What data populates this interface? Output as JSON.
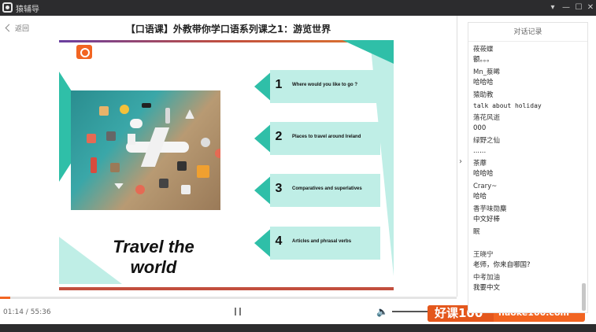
{
  "app": {
    "title": "猿辅导"
  },
  "window_controls": [
    "▾",
    "—",
    "☐",
    "✕"
  ],
  "header": {
    "back_label": "返回",
    "course_title": "【口语课】外教带你学口语系列课之1：游览世界"
  },
  "slide": {
    "title": "Travel the world",
    "items": [
      {
        "num": "1",
        "text": "Where would you like to go ?"
      },
      {
        "num": "2",
        "text": "Places to travel around Ireland"
      },
      {
        "num": "3",
        "text": "Comparatives and superlatives"
      },
      {
        "num": "4",
        "text": "Articles and phrasal verbs"
      }
    ]
  },
  "player": {
    "time": "01:14 / 55:36",
    "progress_fraction": 0.022
  },
  "watermark": {
    "left": "好课100",
    "right": "haoke100.com"
  },
  "chat": {
    "title": "对话记录",
    "messages": [
      {
        "user": "莜莜蝶",
        "text": "额。。。"
      },
      {
        "user": "Mn_蔡晞",
        "text": "哈哈哈"
      },
      {
        "user": "猿助教",
        "text": "talk about holiday"
      },
      {
        "user": "落花风逝",
        "text": "000"
      },
      {
        "user": "绿野之仙",
        "text": "......"
      },
      {
        "user": "茶蘼",
        "text": "哈哈哈"
      },
      {
        "user": "Crary~",
        "text": "哈哈"
      },
      {
        "user": "香芋味勋麋",
        "text": "中文好棒"
      },
      {
        "user": "眠",
        "text": ""
      },
      {
        "user": "王晓宁",
        "text": "老师，你来自哪国?"
      },
      {
        "user": "中考加油",
        "text": "我要中文"
      }
    ]
  },
  "colors": {
    "accent": "#f26522",
    "teal": "#2fbfa8",
    "teal_light": "#bfeee6",
    "titlebar": "#2c2c2e"
  }
}
